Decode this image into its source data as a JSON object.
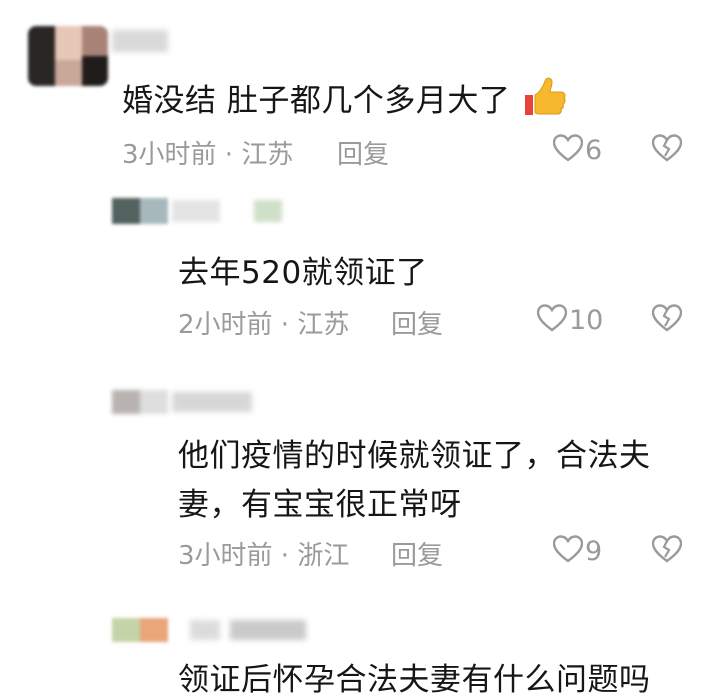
{
  "comments": [
    {
      "text": "婚没结 肚子都几个多月大了",
      "emoji": "thumbs-up-icon",
      "time_location": "3小时前 · 江苏",
      "reply_label": "回复",
      "likes": "6"
    },
    {
      "text": "去年520就领证了",
      "time_location": "2小时前 · 江苏",
      "reply_label": "回复",
      "likes": "10"
    },
    {
      "text_line1": "他们疫情的时候就领证了，合法夫",
      "text_line2": "妻，有宝宝很正常呀",
      "time_location": "3小时前 · 浙江",
      "reply_label": "回复",
      "likes": "9"
    },
    {
      "text": "领证后怀孕合法夫妻有什么问题吗"
    }
  ],
  "colors": {
    "meta_gray": "#9a9a9a",
    "text": "#161616",
    "thumb_yellow": "#f5b82e",
    "thumb_red": "#e8433a"
  }
}
